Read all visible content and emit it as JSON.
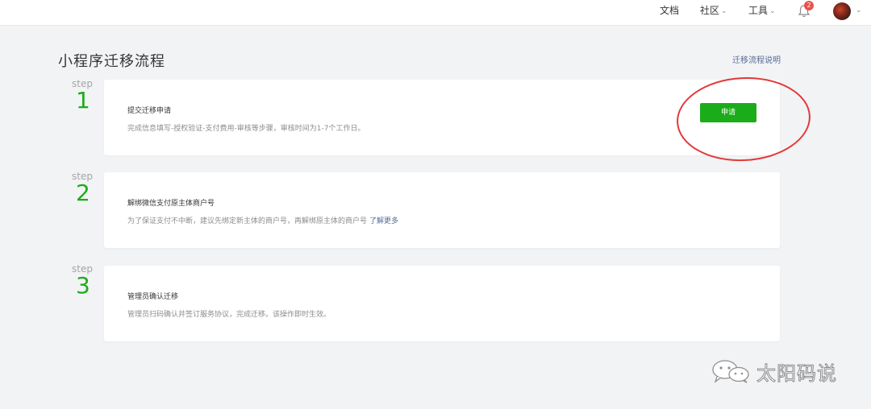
{
  "nav": {
    "docs": "文档",
    "community": "社区",
    "tools": "工具",
    "notification_count": "2"
  },
  "page": {
    "title": "小程序迁移流程",
    "help_link": "迁移流程说明"
  },
  "steps": [
    {
      "word": "step",
      "number": "1",
      "title": "提交迁移申请",
      "desc": "完成信息填写-授权验证-支付费用-审核等步骤，审核时间为1-7个工作日。",
      "action": "申请"
    },
    {
      "word": "step",
      "number": "2",
      "title": "解绑微信支付原主体商户号",
      "desc": "为了保证支付不中断，建议先绑定新主体的商户号，再解绑原主体的商户号",
      "link": "了解更多"
    },
    {
      "word": "step",
      "number": "3",
      "title": "管理员确认迁移",
      "desc": "管理员扫码确认并签订服务协议，完成迁移。该操作即时生效。"
    }
  ],
  "watermark": {
    "text": "太阳码说"
  },
  "colors": {
    "accent": "#1aad19",
    "link": "#576b95",
    "annotation": "#e2393b",
    "badge": "#e9524a"
  }
}
